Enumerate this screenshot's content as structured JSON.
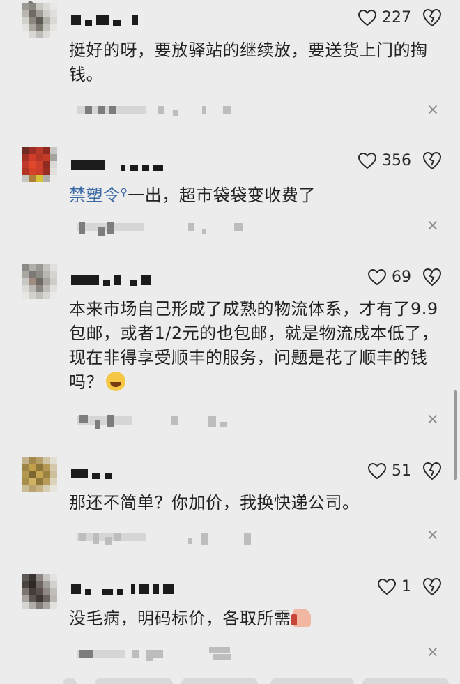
{
  "comments": [
    {
      "likes": "227",
      "text": "挺好的呀，要放驿站的继续放，要送货上门的掏钱。"
    },
    {
      "likes": "356",
      "mention": "禁塑令",
      "text": "一出，超市袋袋变收费了"
    },
    {
      "likes": "69",
      "text": "本来市场自己形成了成熟的物流体系，才有了9.9包邮，或者1/2元的也包邮，就是物流成本低了，现在非得享受顺丰的服务，问题是花了顺丰的钱吗？"
    },
    {
      "likes": "51",
      "text": "那还不简单？你加价，我换快递公司。"
    },
    {
      "likes": "1",
      "text": "没毛病，明码标价，各取所需"
    }
  ],
  "icons": {
    "like": "heart-outline-icon",
    "dislike": "broken-heart-icon",
    "close": "close-icon",
    "emoji": "laughing-face-icon",
    "thumbs_up": "thumbs-up-icon"
  },
  "close_glyph": "×",
  "colors": {
    "background": "#ececec",
    "mention": "#3d6aa5",
    "text": "#222222"
  }
}
